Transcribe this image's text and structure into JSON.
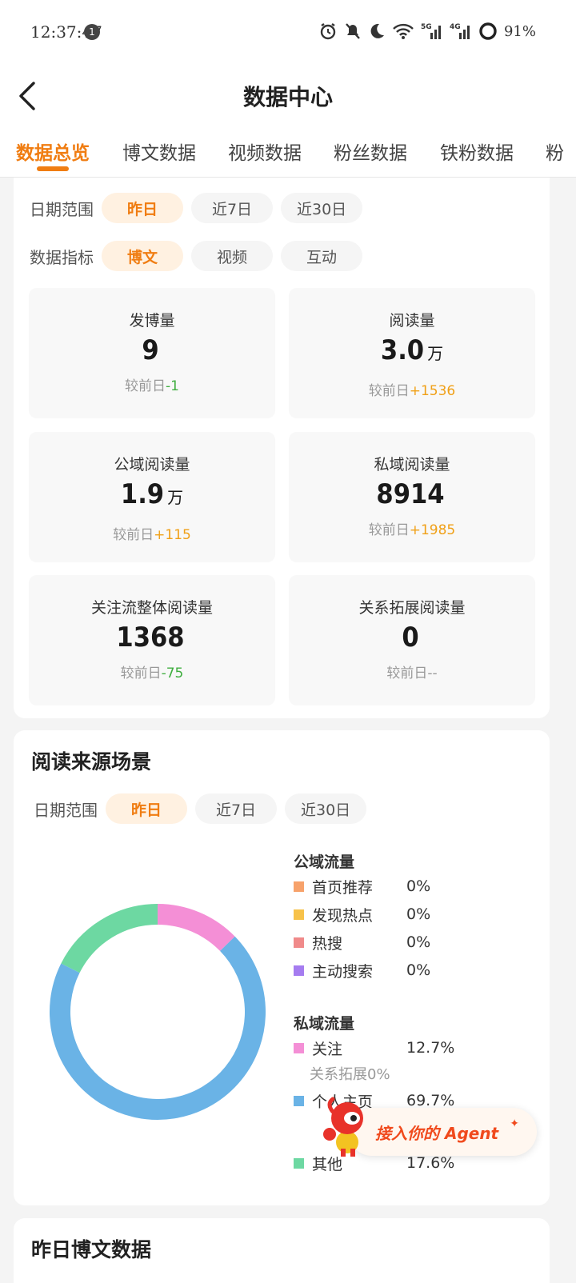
{
  "status_bar": {
    "time": "12:37:47",
    "notification_count": "1",
    "network_5g": "5G",
    "network_4g": "4G",
    "battery": "91%"
  },
  "header": {
    "title": "数据中心"
  },
  "tabs": [
    {
      "label": "数据总览",
      "active": true
    },
    {
      "label": "博文数据",
      "active": false
    },
    {
      "label": "视频数据",
      "active": false
    },
    {
      "label": "粉丝数据",
      "active": false
    },
    {
      "label": "铁粉数据",
      "active": false
    },
    {
      "label": "粉",
      "active": false
    }
  ],
  "overview": {
    "date_range_label": "日期范围",
    "date_options": [
      "昨日",
      "近7日",
      "近30日"
    ],
    "date_selected": "昨日",
    "metric_label": "数据指标",
    "metric_options": [
      "博文",
      "视频",
      "互动"
    ],
    "metric_selected": "博文",
    "stats": [
      {
        "label": "发博量",
        "value": "9",
        "unit": "",
        "compare_prefix": "较前日",
        "compare": "-1",
        "trend": "down"
      },
      {
        "label": "阅读量",
        "value": "3.0",
        "unit": "万",
        "compare_prefix": "较前日",
        "compare": "+1536",
        "trend": "up"
      },
      {
        "label": "公域阅读量",
        "value": "1.9",
        "unit": "万",
        "compare_prefix": "较前日",
        "compare": "+115",
        "trend": "up"
      },
      {
        "label": "私域阅读量",
        "value": "8914",
        "unit": "",
        "compare_prefix": "较前日",
        "compare": "+1985",
        "trend": "up"
      },
      {
        "label": "关注流整体阅读量",
        "value": "1368",
        "unit": "",
        "compare_prefix": "较前日",
        "compare": "-75",
        "trend": "down"
      },
      {
        "label": "关系拓展阅读量",
        "value": "0",
        "unit": "",
        "compare_prefix": "较前日",
        "compare": "--",
        "trend": "none"
      }
    ]
  },
  "read_source": {
    "title": "阅读来源场景",
    "date_range_label": "日期范围",
    "date_options": [
      "昨日",
      "近7日",
      "近30日"
    ],
    "date_selected": "昨日",
    "public_title": "公域流量",
    "public_items": [
      {
        "name": "首页推荐",
        "pct": "0%",
        "color": "#f7a26b"
      },
      {
        "name": "发现热点",
        "pct": "0%",
        "color": "#f7c24a"
      },
      {
        "name": "热搜",
        "pct": "0%",
        "color": "#f08a8a"
      },
      {
        "name": "主动搜索",
        "pct": "0%",
        "color": "#a57cf0"
      }
    ],
    "private_title": "私域流量",
    "private_items": [
      {
        "name": "关注",
        "pct": "12.7%",
        "color": "#f48fd6"
      },
      {
        "name": "个人主页",
        "pct": "69.7%",
        "color": "#6ab3e6"
      },
      {
        "name": "其他",
        "pct": "17.6%",
        "color": "#6dd8a2"
      }
    ],
    "relation_expand_note": "关系拓展0%"
  },
  "chart_data": {
    "type": "pie",
    "categories": [
      "首页推荐",
      "发现热点",
      "热搜",
      "主动搜索",
      "关注",
      "个人主页",
      "其他"
    ],
    "values": [
      0,
      0,
      0,
      0,
      12.7,
      69.7,
      17.6
    ],
    "colors": [
      "#f7a26b",
      "#f7c24a",
      "#f08a8a",
      "#a57cf0",
      "#f48fd6",
      "#6ab3e6",
      "#6dd8a2"
    ],
    "donut": true
  },
  "agent_badge": {
    "text": "接入你的 Agent"
  },
  "next_section": {
    "title": "昨日博文数据"
  }
}
